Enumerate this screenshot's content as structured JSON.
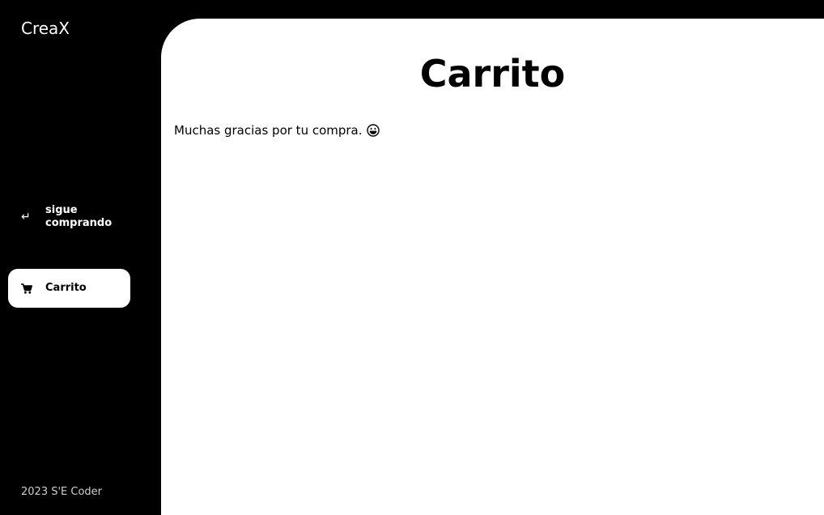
{
  "sidebar": {
    "brand": "CreaX",
    "items": [
      {
        "label": "sigue comprando",
        "icon": "return-arrow-icon"
      },
      {
        "label": "Carrito",
        "icon": "cart-icon",
        "active": true
      }
    ],
    "footer": "2023 S'E Coder"
  },
  "main": {
    "title": "Carrito",
    "message": "Muchas gracias por tu compra.",
    "message_icon": "grinning-face-icon"
  },
  "colors": {
    "sidebar_bg": "#000000",
    "main_bg": "#ffffff",
    "active_item_bg": "#ffffff",
    "footer_text": "#cfcfcf"
  }
}
